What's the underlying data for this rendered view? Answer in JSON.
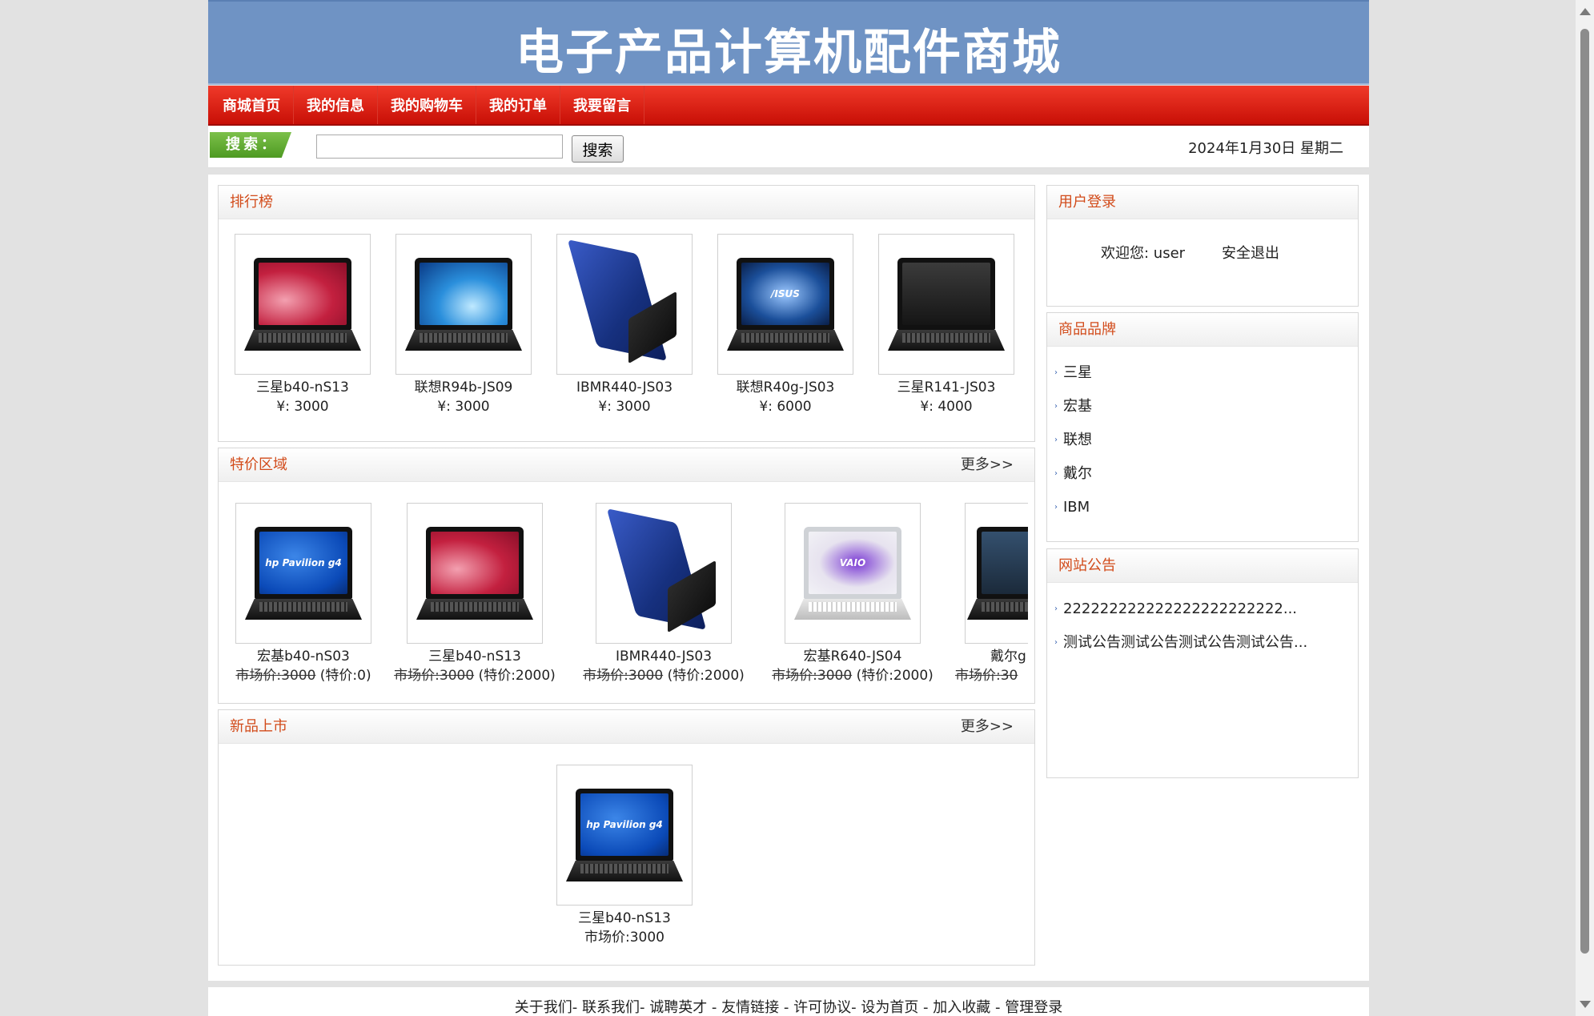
{
  "header": {
    "title": "电子产品计算机配件商城"
  },
  "nav": [
    {
      "label": "商城首页"
    },
    {
      "label": "我的信息"
    },
    {
      "label": "我的购物车"
    },
    {
      "label": "我的订单"
    },
    {
      "label": "我要留言"
    }
  ],
  "search": {
    "tag_label": "搜索：",
    "value": "",
    "placeholder": "",
    "button_label": "搜索"
  },
  "date_text": "2024年1月30日 星期二",
  "ranking": {
    "title": "排行榜",
    "items": [
      {
        "name": "三星b40-nS13",
        "price": "¥: 3000",
        "screen": "red-wave"
      },
      {
        "name": "联想R94b-JS09",
        "price": "¥: 3000",
        "screen": "blue-splash"
      },
      {
        "name": "IBMR440-JS03",
        "price": "¥: 3000",
        "screen": "blue-lid"
      },
      {
        "name": "联想R40g-JS03",
        "price": "¥: 6000",
        "screen": "asus"
      },
      {
        "name": "三星R141-JS03",
        "price": "¥: 4000",
        "screen": "dark"
      }
    ]
  },
  "special": {
    "title": "特价区域",
    "more": "更多>>",
    "market_label": "市场价:",
    "items": [
      {
        "name": "宏基b40-nS03",
        "market_price": "3000",
        "special_price": "(特价:0)",
        "screen": "hp"
      },
      {
        "name": "三星b40-nS13",
        "market_price": "3000",
        "special_price": "(特价:2000)",
        "screen": "red-wave"
      },
      {
        "name": "IBMR440-JS03",
        "market_price": "3000",
        "special_price": "(特价:2000)",
        "screen": "blue-lid"
      },
      {
        "name": "宏基R640-JS04",
        "market_price": "3000",
        "special_price": "(特价:2000)",
        "screen": "vaio"
      },
      {
        "name": "戴尔g",
        "market_price": "30",
        "special_price": "",
        "screen": "city"
      }
    ]
  },
  "new_arrivals": {
    "title": "新品上市",
    "more": "更多>>",
    "items": [
      {
        "name": "三星b40-nS13",
        "price": "市场价:3000",
        "screen": "hp"
      }
    ]
  },
  "login": {
    "title": "用户登录",
    "welcome": "欢迎您: user",
    "logout": "安全退出"
  },
  "brands": {
    "title": "商品品牌",
    "items": [
      "三星",
      "宏基",
      "联想",
      "戴尔",
      "IBM"
    ]
  },
  "notices": {
    "title": "网站公告",
    "items": [
      "222222222222222222222222...",
      "测试公告测试公告测试公告测试公告..."
    ]
  },
  "hp_logo": "hp",
  "hp_model": "Pavilion g4",
  "asus_logo": "/ISUS",
  "vaio_logo": "VAIO",
  "footer": {
    "links": [
      "关于我们",
      "联系我们",
      "诚聘英才",
      "友情链接",
      "许可协议",
      "设为首页",
      "加入收藏",
      "管理登录"
    ]
  }
}
